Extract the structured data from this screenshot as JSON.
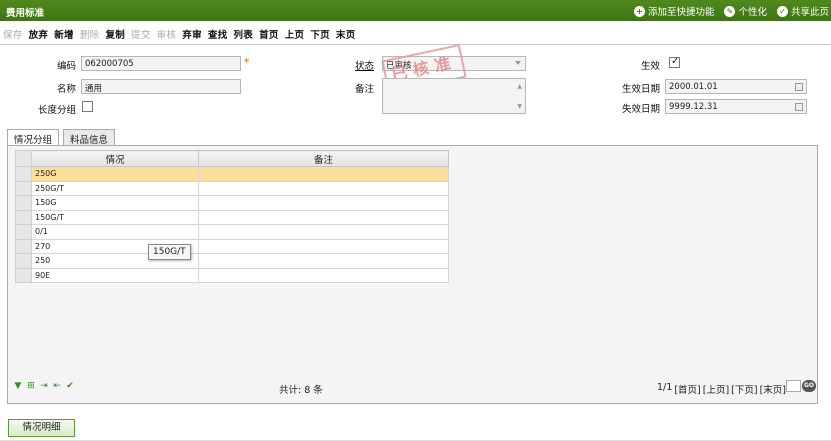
{
  "window": {
    "title": "费用标准",
    "links": [
      {
        "icon": "plus-circle-icon",
        "label": "添加至快捷功能"
      },
      {
        "icon": "wrench-icon",
        "label": "个性化"
      },
      {
        "icon": "check-circle-icon",
        "label": "共享此页"
      }
    ]
  },
  "toolbar": {
    "save": "保存",
    "discard": "放弃",
    "add": "新增",
    "delete": "删除",
    "copy": "复制",
    "submit": "提交",
    "review": "审核",
    "reject": "弃审",
    "find": "查找",
    "list": "列表",
    "first": "首页",
    "prev": "上页",
    "next": "下页",
    "last": "末页"
  },
  "form": {
    "code_label": "编码",
    "code_value": "062000705",
    "required_mark": "*",
    "name_label": "名称",
    "name_value": "通用",
    "length_group_label": "长度分组",
    "length_group_checked": false,
    "status_label": "状态",
    "status_value": "已审核",
    "remark_label": "备注",
    "remark_value": "",
    "stamp_text": "已核准",
    "effective_label": "生效",
    "effective_checked": true,
    "effective_date_label": "生效日期",
    "effective_date_value": "2000.01.01",
    "expiry_date_label": "失效日期",
    "expiry_date_value": "9999.12.31"
  },
  "tabs": [
    {
      "label": "情况分组",
      "active": true
    },
    {
      "label": "料品信息",
      "active": false
    }
  ],
  "grid": {
    "columns": [
      "情况",
      "备注"
    ],
    "rows": [
      {
        "situation": "250G",
        "remark": "",
        "selected": true
      },
      {
        "situation": "250G/T",
        "remark": "",
        "selected": false
      },
      {
        "situation": "150G",
        "remark": "",
        "selected": false
      },
      {
        "situation": "150G/T",
        "remark": "",
        "selected": false
      },
      {
        "situation": "0/1",
        "remark": "",
        "selected": false
      },
      {
        "situation": "270",
        "remark": "",
        "selected": false
      },
      {
        "situation": "250",
        "remark": "",
        "selected": false
      },
      {
        "situation": "90E",
        "remark": "",
        "selected": false
      }
    ],
    "tooltip": "150G/T",
    "total": "共计: 8 条",
    "pager": {
      "page_info": "1/1",
      "first": "[首页]",
      "prev": "[上页]",
      "next": "[下页]",
      "last": "[末页]",
      "go": "GO"
    }
  },
  "footer": {
    "detail_button": "情况明细"
  },
  "colors": {
    "titlebar": "#3f7514",
    "selected_row": "#fbdd9c",
    "required": "#e0661e",
    "stamp": "#e38a8a"
  }
}
